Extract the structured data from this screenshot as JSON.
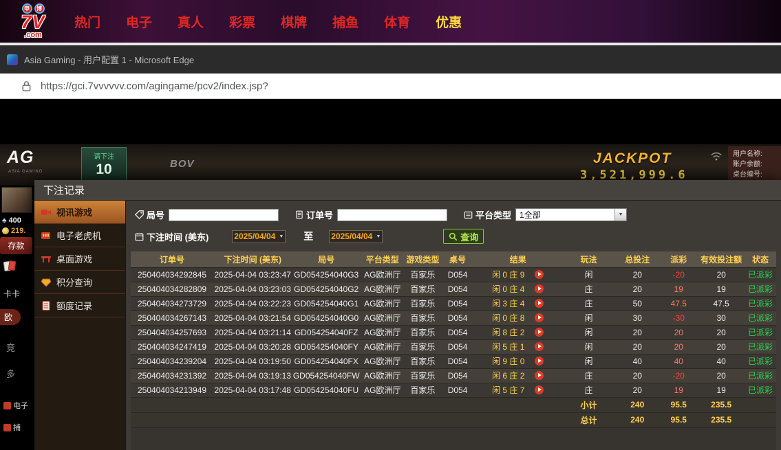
{
  "nav": {
    "logo": {
      "badge_left": "申",
      "badge_right": "博",
      "main": "7V",
      "sub": ".com"
    },
    "items": [
      {
        "label": "热门",
        "active": false
      },
      {
        "label": "电子",
        "active": false
      },
      {
        "label": "真人",
        "active": false
      },
      {
        "label": "彩票",
        "active": false
      },
      {
        "label": "棋牌",
        "active": false
      },
      {
        "label": "捕鱼",
        "active": false
      },
      {
        "label": "体育",
        "active": false
      },
      {
        "label": "优惠",
        "active": true
      }
    ]
  },
  "browser": {
    "window_title": "Asia Gaming - 用户配置 1 - Microsoft Edge",
    "url": "https://gci.7vvvvvv.com/agingame/pcv2/index.jsp?"
  },
  "game": {
    "ag_logo": "AG",
    "ag_sub": "ASIA GAMING",
    "bet_prompt": "请下注",
    "countdown": "10",
    "brand": "BOV",
    "jackpot_label": "JACKPOT",
    "jackpot_value": "3,521,999.6",
    "user_panel": [
      "用户名称:",
      "账户余额:",
      "桌台编号:"
    ]
  },
  "left_rail": {
    "balance1": "400",
    "balance2": "219.",
    "deposit": "存款",
    "fragments": [
      "卡卡",
      "欧",
      "竞",
      "多",
      "电子",
      "捕"
    ]
  },
  "modal": {
    "title": "下注记录",
    "sidebar": [
      {
        "label": "视讯游戏",
        "icon": "camera",
        "active": true
      },
      {
        "label": "电子老虎机",
        "icon": "slot",
        "active": false
      },
      {
        "label": "桌面游戏",
        "icon": "tablegame",
        "active": false
      },
      {
        "label": "积分查询",
        "icon": "points",
        "active": false
      },
      {
        "label": "额度记录",
        "icon": "record",
        "active": false
      }
    ],
    "filters": {
      "round_label": "局号",
      "order_label": "订单号",
      "platform_label": "平台类型",
      "platform_value": "1全部",
      "date_label": "下注时间 (美东)",
      "date_from": "2025/04/04",
      "to_label": "至",
      "date_to": "2025/04/04",
      "search_button": "查询"
    },
    "table": {
      "headers": [
        "订单号",
        "下注时间 (美东)",
        "局号",
        "平台类型",
        "游戏类型",
        "桌号",
        "结果",
        "玩法",
        "总投注",
        "派彩",
        "有效投注额",
        "状态"
      ],
      "rows": [
        {
          "order": "250404034292845",
          "time": "2025-04-04 03:23:47",
          "round": "GD054254040G3",
          "platform": "AG欧洲厅",
          "game": "百家乐",
          "table": "D054",
          "result": "闲 0 庄 9",
          "play": "闲",
          "total": "20",
          "payout": "-20",
          "valid": "20",
          "status": "已派彩"
        },
        {
          "order": "250404034282809",
          "time": "2025-04-04 03:23:03",
          "round": "GD054254040G2",
          "platform": "AG欧洲厅",
          "game": "百家乐",
          "table": "D054",
          "result": "闲 0 庄 4",
          "play": "庄",
          "total": "20",
          "payout": "19",
          "valid": "19",
          "status": "已派彩"
        },
        {
          "order": "250404034273729",
          "time": "2025-04-04 03:22:23",
          "round": "GD054254040G1",
          "platform": "AG欧洲厅",
          "game": "百家乐",
          "table": "D054",
          "result": "闲 3 庄 4",
          "play": "庄",
          "total": "50",
          "payout": "47.5",
          "valid": "47.5",
          "status": "已派彩"
        },
        {
          "order": "250404034267143",
          "time": "2025-04-04 03:21:54",
          "round": "GD054254040G0",
          "platform": "AG欧洲厅",
          "game": "百家乐",
          "table": "D054",
          "result": "闲 0 庄 8",
          "play": "闲",
          "total": "30",
          "payout": "-30",
          "valid": "30",
          "status": "已派彩"
        },
        {
          "order": "250404034257693",
          "time": "2025-04-04 03:21:14",
          "round": "GD054254040FZ",
          "platform": "AG欧洲厅",
          "game": "百家乐",
          "table": "D054",
          "result": "闲 8 庄 2",
          "play": "闲",
          "total": "20",
          "payout": "20",
          "valid": "20",
          "status": "已派彩"
        },
        {
          "order": "250404034247419",
          "time": "2025-04-04 03:20:28",
          "round": "GD054254040FY",
          "platform": "AG欧洲厅",
          "game": "百家乐",
          "table": "D054",
          "result": "闲 5 庄 1",
          "play": "闲",
          "total": "20",
          "payout": "20",
          "valid": "20",
          "status": "已派彩"
        },
        {
          "order": "250404034239204",
          "time": "2025-04-04 03:19:50",
          "round": "GD054254040FX",
          "platform": "AG欧洲厅",
          "game": "百家乐",
          "table": "D054",
          "result": "闲 9 庄 0",
          "play": "闲",
          "total": "40",
          "payout": "40",
          "valid": "40",
          "status": "已派彩"
        },
        {
          "order": "250404034231392",
          "time": "2025-04-04 03:19:13",
          "round": "GD054254040FW",
          "platform": "AG欧洲厅",
          "game": "百家乐",
          "table": "D054",
          "result": "闲 6 庄 2",
          "play": "庄",
          "total": "20",
          "payout": "-20",
          "valid": "20",
          "status": "已派彩"
        },
        {
          "order": "250404034213949",
          "time": "2025-04-04 03:17:48",
          "round": "GD054254040FU",
          "platform": "AG欧洲厅",
          "game": "百家乐",
          "table": "D054",
          "result": "闲 5 庄 7",
          "play": "庄",
          "total": "20",
          "payout": "19",
          "valid": "19",
          "status": "已派彩"
        }
      ],
      "subtotal": {
        "label": "小计",
        "total": "240",
        "payout": "95.5",
        "valid": "235.5"
      },
      "grand_total": {
        "label": "总计",
        "total": "240",
        "payout": "95.5",
        "valid": "235.5"
      }
    }
  }
}
